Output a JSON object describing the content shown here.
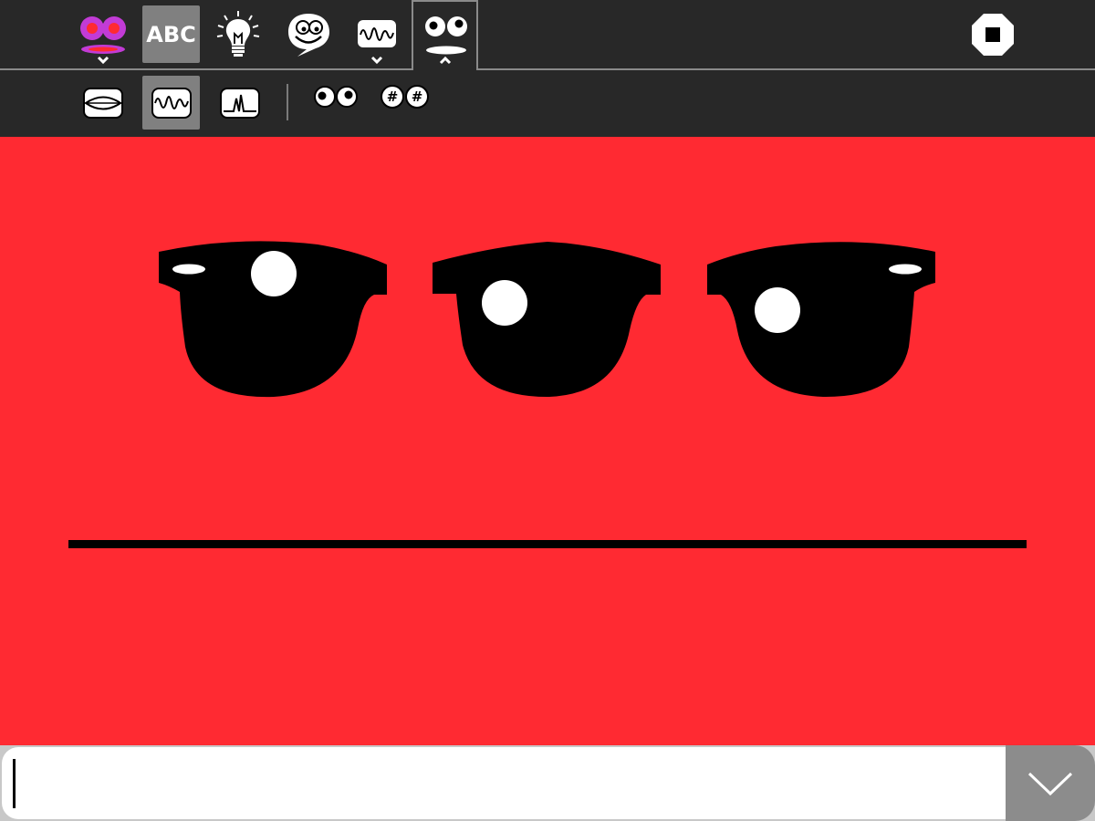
{
  "colors": {
    "face_background": "#ff2a32",
    "toolbar_background": "#282828",
    "selected_button": "#808080",
    "send_button": "#8c8c8c"
  },
  "toolbar": {
    "buttons": [
      {
        "name": "face-voice",
        "icon": "purple-face-icon",
        "has_dropdown": true
      },
      {
        "name": "abc-text",
        "label": "ABC",
        "selected": true
      },
      {
        "name": "idea",
        "icon": "lightbulb-icon"
      },
      {
        "name": "speech",
        "icon": "speech-bubble-face-icon"
      },
      {
        "name": "waveform",
        "icon": "waveform-icon",
        "has_dropdown": true
      },
      {
        "name": "face-settings",
        "icon": "eyes-mouth-icon",
        "expanded": true
      }
    ],
    "stop_icon": "stop-icon"
  },
  "subbar": {
    "mouth_options": [
      {
        "name": "mouth-shape",
        "icon": "lips-icon"
      },
      {
        "name": "mouth-wave",
        "icon": "waveform-icon",
        "selected": true
      },
      {
        "name": "mouth-pulse",
        "icon": "pulse-icon"
      }
    ],
    "eye_options": [
      {
        "name": "eyes-round",
        "icon": "round-eyes-icon"
      },
      {
        "name": "eyes-number",
        "icon": "hash-eyes-icon",
        "glyph": "#"
      }
    ]
  },
  "input": {
    "value": "",
    "send_icon": "chevron-down-icon"
  }
}
